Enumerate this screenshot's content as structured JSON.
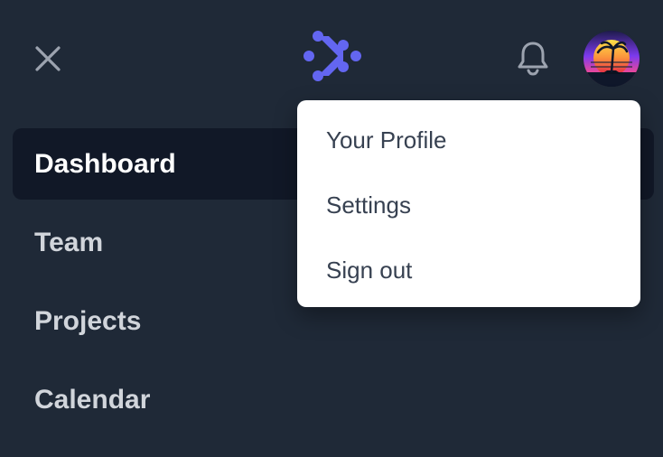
{
  "header": {
    "close_icon": "close-icon",
    "logo": "brand-logo",
    "notification_icon": "bell-icon",
    "avatar": "user-avatar"
  },
  "nav": {
    "items": [
      {
        "label": "Dashboard",
        "active": true
      },
      {
        "label": "Team",
        "active": false
      },
      {
        "label": "Projects",
        "active": false
      },
      {
        "label": "Calendar",
        "active": false
      }
    ]
  },
  "user_menu": {
    "items": [
      {
        "label": "Your Profile"
      },
      {
        "label": "Settings"
      },
      {
        "label": "Sign out"
      }
    ]
  },
  "colors": {
    "background": "#1f2937",
    "active_item": "#111827",
    "brand": "#6366f1",
    "menu_text": "#374151"
  }
}
